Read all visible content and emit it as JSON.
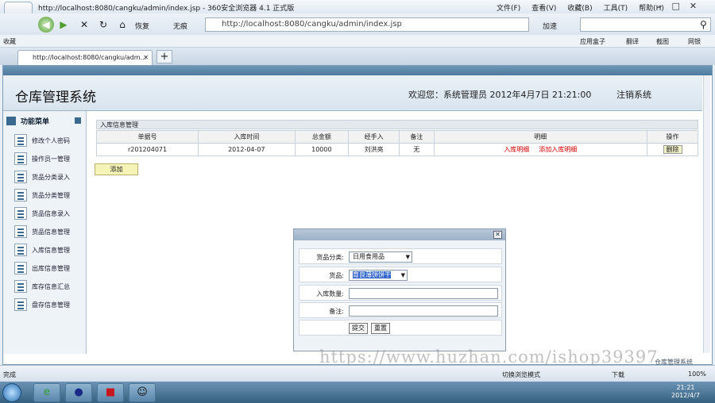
{
  "browser": {
    "window_title": "http://localhost:8080/cangku/admin/index.jsp - 360安全浏览器 4.1 正式版",
    "menu": [
      "文件(F)",
      "查看(V)",
      "收藏(B)",
      "工具(T)",
      "帮助(H)"
    ],
    "back_history_label": "恢复",
    "trace_label": "无痕",
    "url": "http://localhost:8080/cangku/admin/index.jsp",
    "speed_label": "加速",
    "favorites_label": "收藏",
    "fav_right": [
      "应用盒子",
      "翻译",
      "截图",
      "网银"
    ],
    "tab_label": "http://localhost:8080/cangku/adm...",
    "status_left": "完成",
    "status_right": [
      "切换浏览模式",
      "下载",
      "100%"
    ]
  },
  "header": {
    "strip_text": "",
    "system_title": "仓库管理系统",
    "welcome": "欢迎您：系统管理员    2012年4月7日  21:21:00",
    "logout": "注销系统"
  },
  "sidebar": {
    "title": "功能菜单",
    "items": [
      "修改个人密码",
      "操作员一管理",
      "货品分类录入",
      "货品分类管理",
      "货品信息录入",
      "货品信息管理",
      "入库信息管理",
      "出库信息管理",
      "库存信息汇总",
      "盘存信息管理"
    ]
  },
  "main": {
    "panel_title": "入库信息管理",
    "columns": [
      "单据号",
      "入库时间",
      "总金额",
      "经手入",
      "备注",
      "明细",
      "操作"
    ],
    "rows": [
      {
        "id": "r201204071",
        "date": "2012-04-07",
        "amount": "10000",
        "handler": "刘洪亮",
        "note": "无",
        "detail_link": "入库明细",
        "add_detail_link": "添加入库明细",
        "action": "删除"
      }
    ],
    "add_button": "添加"
  },
  "dialog": {
    "category_label": "货品分类:",
    "category_value": "日用食用品",
    "goods_label": "货品:",
    "goods_value": "育良薄饼饼干",
    "qty_label": "入库数量:",
    "note_label": "备注:",
    "submit": "提交",
    "reset": "重置"
  },
  "footer_text": "仓库管理系统",
  "watermark": "https://www.huzhan.com/ishop39397",
  "taskbar": {
    "time": "21:21",
    "date": "2012/4/7"
  },
  "colors": {
    "link_red": "#d20000",
    "header_bg": "#d8e4ee",
    "strip": "#4d7a9e"
  }
}
